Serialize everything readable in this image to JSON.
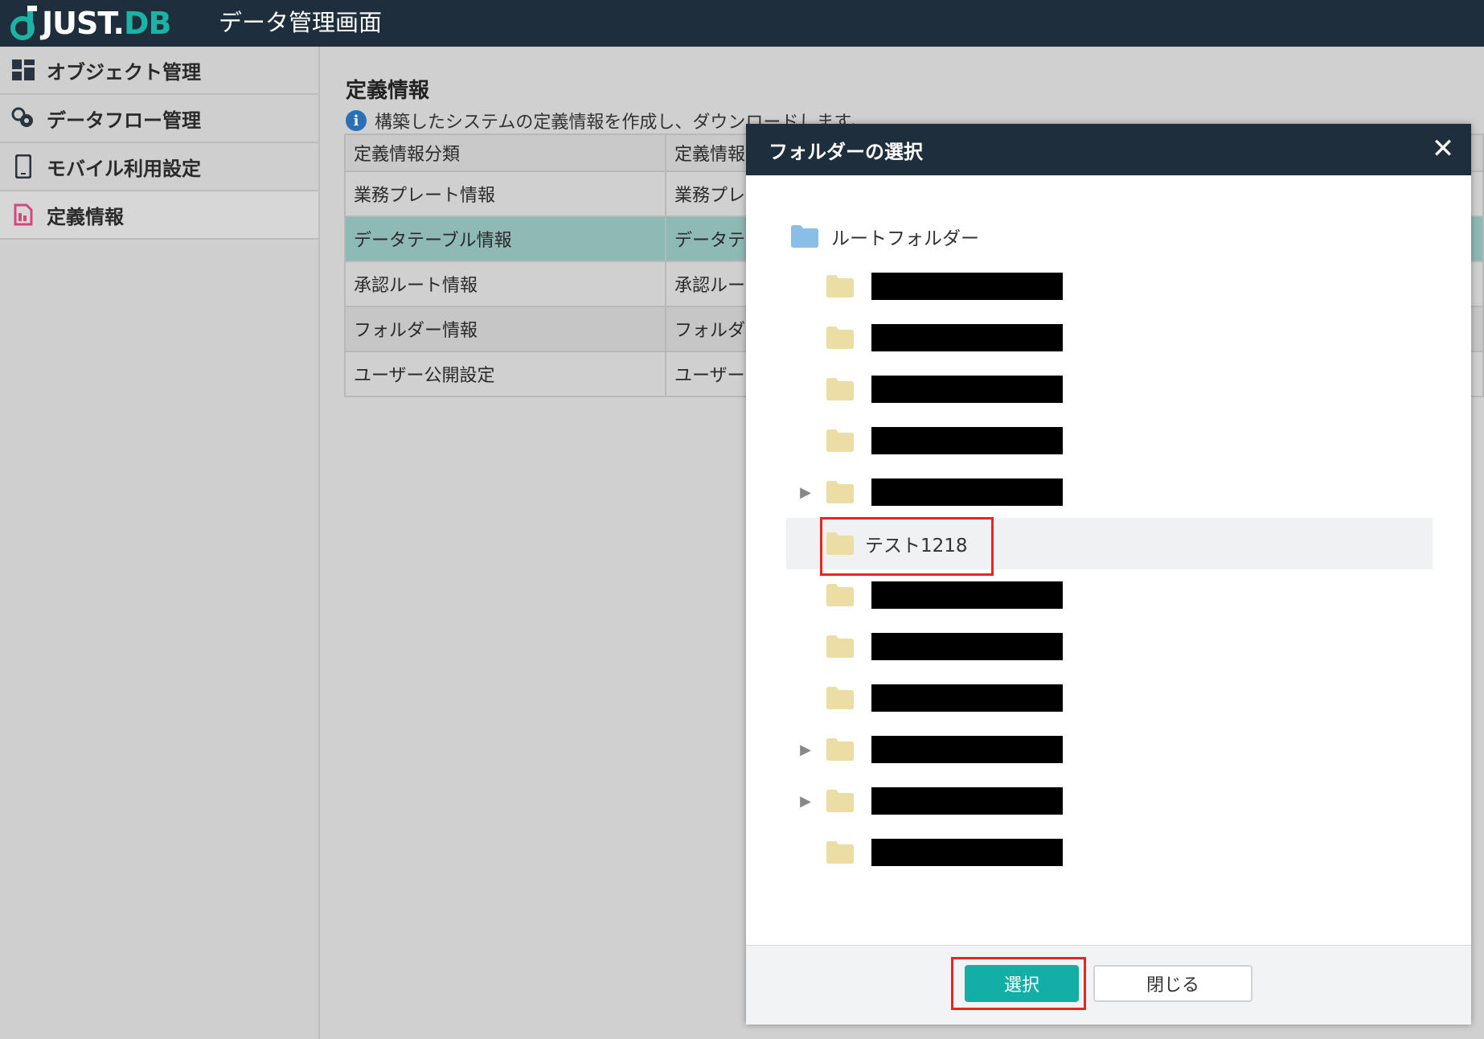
{
  "header": {
    "logo_main": "JUST.",
    "logo_db": "DB",
    "app_title": "データ管理画面"
  },
  "sidebar": {
    "items": [
      {
        "label": "オブジェクト管理",
        "icon": "dashboard-icon"
      },
      {
        "label": "データフロー管理",
        "icon": "dataflow-icon"
      },
      {
        "label": "モバイル利用設定",
        "icon": "mobile-icon"
      },
      {
        "label": "定義情報",
        "icon": "definition-icon"
      }
    ]
  },
  "main": {
    "title": "定義情報",
    "description": "構築したシステムの定義情報を作成し、ダウンロードします。",
    "table": {
      "headers": [
        "定義情報分類",
        "定義情報"
      ],
      "rows": [
        [
          "業務プレート情報",
          "業務プレ"
        ],
        [
          "データテーブル情報",
          "データテ"
        ],
        [
          "承認ルート情報",
          "承認ルー"
        ],
        [
          "フォルダー情報",
          "フォルダ"
        ],
        [
          "ユーザー公開設定",
          "ユーザー"
        ]
      ]
    }
  },
  "dialog": {
    "title": "フォルダーの選択",
    "close_symbol": "✕",
    "root_label": "ルートフォルダー",
    "highlighted_folder": "テスト1218",
    "select_button": "選択",
    "close_button": "閉じる"
  },
  "colors": {
    "header_bg": "#1f2e3c",
    "accent": "#13aea6",
    "selected_row": "#8fb9b5",
    "annotation_red": "#e8261b"
  }
}
